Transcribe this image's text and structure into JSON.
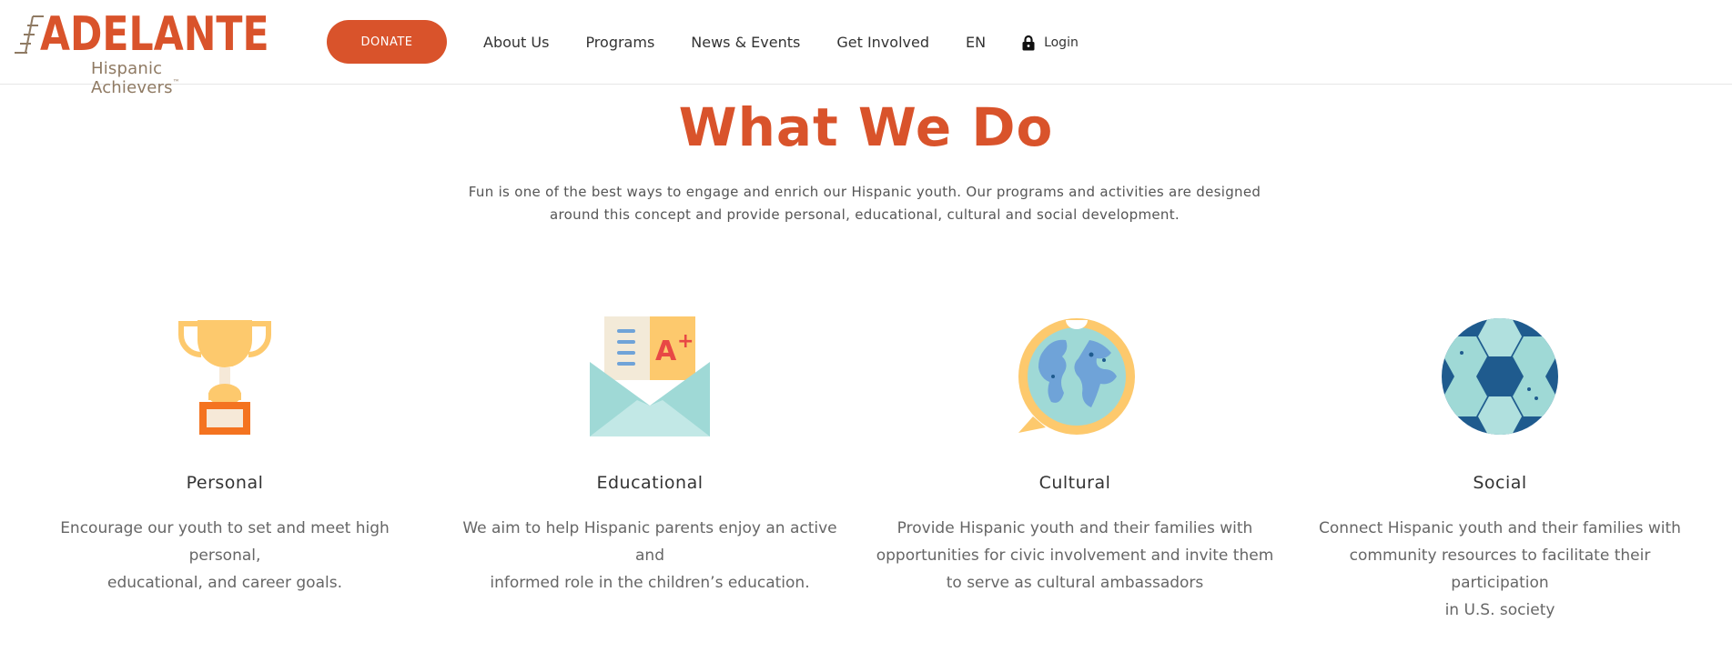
{
  "header": {
    "logo": {
      "word": "ADELANTE",
      "sub": "Hispanic Achievers",
      "tm": "™"
    },
    "donate_label": "DONATE",
    "nav": [
      {
        "label": "About Us"
      },
      {
        "label": "Programs"
      },
      {
        "label": "News & Events"
      },
      {
        "label": "Get Involved"
      },
      {
        "label": "EN"
      }
    ],
    "login_label": "Login"
  },
  "main": {
    "title": "What We Do",
    "intro_line1": "Fun is one of the best ways to engage and enrich our Hispanic youth. Our programs and activities are designed",
    "intro_line2": "around this concept and provide personal, educational, cultural and social development.",
    "cards": [
      {
        "icon": "trophy-icon",
        "title": "Personal",
        "lines": [
          "Encourage our youth to set and meet high personal,",
          "educational, and career goals."
        ]
      },
      {
        "icon": "envelope-grade-icon",
        "title": "Educational",
        "lines": [
          "We aim to help Hispanic parents enjoy an active and",
          "informed role in the children’s education."
        ]
      },
      {
        "icon": "globe-speech-icon",
        "title": "Cultural",
        "lines": [
          "Provide Hispanic youth and their families with",
          "opportunities for civic involvement and invite them",
          "to serve as cultural ambassadors"
        ]
      },
      {
        "icon": "soccer-ball-icon",
        "title": "Social",
        "lines": [
          "Connect Hispanic youth and their families with",
          "community resources to facilitate their participation",
          "in U.S. society"
        ]
      }
    ]
  },
  "colors": {
    "brand": "#d9532b",
    "logo_sub": "#8f7a63",
    "icon_yellow": "#fdc96d",
    "icon_orange": "#f47320",
    "icon_teal": "#9fd9d6",
    "icon_blue": "#1f5b8e",
    "icon_lightblue": "#6fa3d8"
  }
}
